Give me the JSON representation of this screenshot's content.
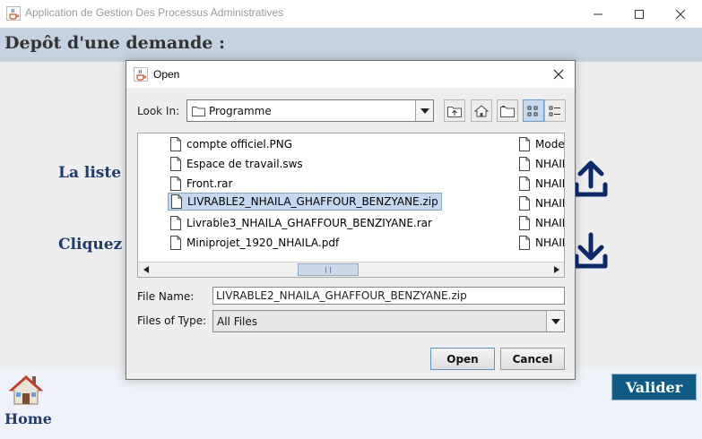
{
  "window": {
    "title": "Application de Gestion Des Processus Administratives"
  },
  "page": {
    "title": "Depôt d'une demande :",
    "label_list": "La liste d",
    "label_click": "Cliquez i",
    "home_label": "Home",
    "valider_label": "Valider"
  },
  "dialog": {
    "title": "Open",
    "look_in_label": "Look In:",
    "look_in_value": "Programme",
    "files": [
      "compte officiel.PNG",
      "Espace de travail.sws",
      "Front.rar",
      "LIVRABLE2_NHAILA_GHAFFOUR_BENZYANE.zip",
      "Livrable3_NHAILA_GHAFFOUR_BENZIYANE.rar",
      "Miniprojet_1920_NHAILA.pdf"
    ],
    "selected_file_index": 3,
    "second_column": [
      "Mode",
      "NHAIL",
      "NHAIL",
      "NHAIL",
      "NHAIL",
      "NHAIL"
    ],
    "file_name_label": "File Name:",
    "file_name_value": "LIVRABLE2_NHAILA_GHAFFOUR_BENZYANE.zip",
    "files_of_type_label": "Files of Type:",
    "files_of_type_value": "All Files",
    "open_button": "Open",
    "cancel_button": "Cancel"
  },
  "colors": {
    "header_band": "#c5d2e0",
    "label_text": "#1f3b6f",
    "valider_bg": "#0f5b86",
    "icon_navy": "#0c2a6b",
    "selection": "#c5d8ee"
  },
  "icons": {
    "app": "java-coffee-cup-icon",
    "upload": "upload-icon",
    "download": "download-icon",
    "home": "home-icon",
    "file": "file-icon",
    "folder": "folder-icon"
  }
}
